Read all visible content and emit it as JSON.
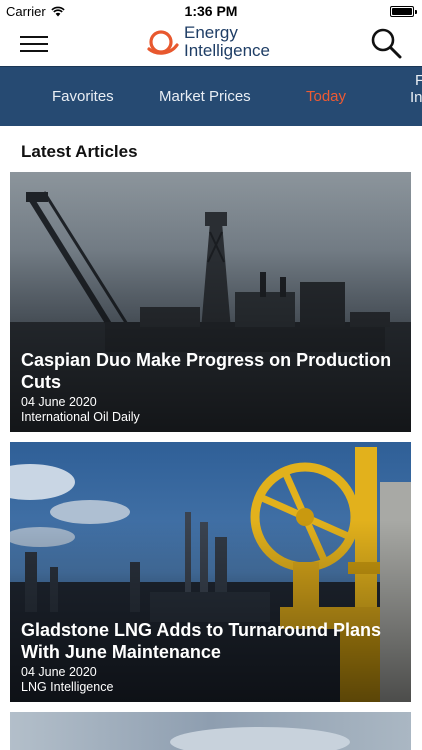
{
  "status": {
    "carrier": "Carrier",
    "time": "1:36 PM"
  },
  "header": {
    "brand_line1": "Energy",
    "brand_line2": "Intelligence",
    "brand_color": "#1f3e66",
    "accent_color": "#e8582e"
  },
  "tabs": [
    {
      "label": "Favorites",
      "active": false
    },
    {
      "label": "Market Prices",
      "active": false
    },
    {
      "label": "Today",
      "active": true
    }
  ],
  "tab_partial": {
    "line1": "F",
    "line2": "In"
  },
  "section": {
    "title": "Latest Articles"
  },
  "articles": [
    {
      "title": "Caspian Duo Make Progress on Production Cuts",
      "date": "04 June 2020",
      "source": "International Oil Daily"
    },
    {
      "title": "Gladstone LNG Adds to Turnaround Plans With June Maintenance",
      "date": "04 June 2020",
      "source": "LNG Intelligence"
    }
  ]
}
